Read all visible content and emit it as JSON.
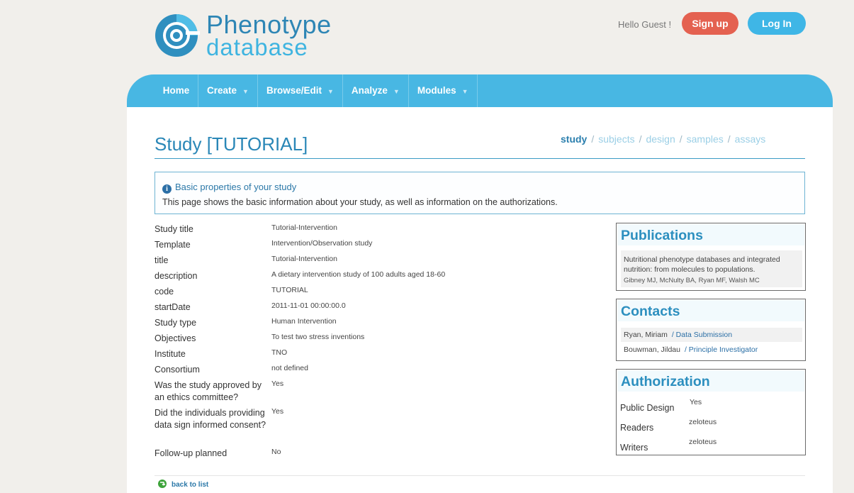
{
  "header": {
    "logo_line1": "Phenotype",
    "logo_line2": "database",
    "greeting": "Hello Guest !",
    "signup_label": "Sign up",
    "login_label": "Log In"
  },
  "nav": {
    "home": "Home",
    "create": "Create",
    "browse": "Browse/Edit",
    "analyze": "Analyze",
    "modules": "Modules"
  },
  "page": {
    "title": "Study [TUTORIAL]",
    "subnav": {
      "study": "study",
      "subjects": "subjects",
      "design": "design",
      "samples": "samples",
      "assays": "assays"
    }
  },
  "info": {
    "title": "Basic properties of your study",
    "text": "This page shows the basic information about your study, as well as information on the authorizations."
  },
  "properties": [
    {
      "label": "Study title",
      "value": "Tutorial-Intervention"
    },
    {
      "label": "Template",
      "value": "Intervention/Observation study"
    },
    {
      "label": "title",
      "value": "Tutorial-Intervention"
    },
    {
      "label": "description",
      "value": "A dietary intervention study of 100 adults aged 18-60"
    },
    {
      "label": "code",
      "value": "TUTORIAL"
    },
    {
      "label": "startDate",
      "value": "2011-11-01 00:00:00.0"
    },
    {
      "label": "Study type",
      "value": "Human Intervention"
    },
    {
      "label": "Objectives",
      "value": "To test two stress inventions"
    },
    {
      "label": "Institute",
      "value": "TNO"
    },
    {
      "label": "Consortium",
      "value": "not defined"
    },
    {
      "label": "Was the study approved by an ethics committee?",
      "value": "Yes"
    },
    {
      "label": "Did the individuals providing data sign informed consent?",
      "value": "Yes"
    },
    {
      "label": "Follow-up planned",
      "value": "No"
    }
  ],
  "publications": {
    "title": "Publications",
    "items": [
      {
        "title": "Nutritional phenotype databases and integrated nutrition: from molecules to populations.",
        "authors": "Gibney MJ, McNulty BA, Ryan MF, Walsh MC"
      }
    ]
  },
  "contacts": {
    "title": "Contacts",
    "items": [
      {
        "name": "Ryan, Miriam",
        "role": "/ Data Submission"
      },
      {
        "name": "Bouwman, Jildau",
        "role": "/ Principle Investigator"
      }
    ]
  },
  "authorization": {
    "title": "Authorization",
    "rows": [
      {
        "label": "Public Design",
        "value": "Yes"
      },
      {
        "label": "Readers",
        "value": "zeloteus"
      },
      {
        "label": "Writers",
        "value": "zeloteus"
      }
    ]
  },
  "footer": {
    "back_label": "back to list"
  },
  "colors": {
    "brand_blue": "#48b7e3",
    "signup": "#e46150",
    "login": "#3fb6e6",
    "title_blue": "#2a87b7"
  }
}
